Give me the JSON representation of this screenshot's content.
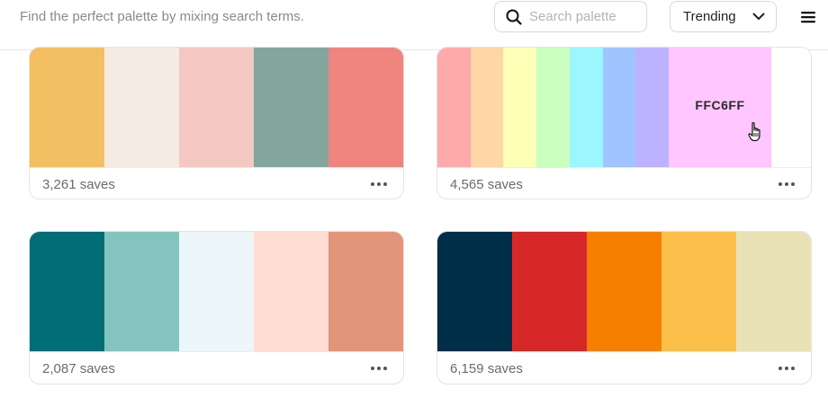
{
  "header": {
    "tagline": "Find the perfect palette by mixing search terms.",
    "search": {
      "placeholder": "Search palette",
      "value": ""
    },
    "sort": {
      "selected": "Trending"
    },
    "icons": {
      "search": "search-icon",
      "sort": "chevron-down-icon",
      "menu": "hamburger-menu-icon"
    }
  },
  "palettes": [
    {
      "colors": [
        "#F4BE62",
        "#F5EBE2",
        "#F5C7C1",
        "#84A59E",
        "#F0847F"
      ],
      "saves": "3,261 saves"
    },
    {
      "colors": [
        "#FFAAAA",
        "#FFD6A5",
        "#FDFFB6",
        "#CAFFBF",
        "#9BF6FF",
        "#A0C4FF",
        "#BDB2FF",
        "#FFC6FF",
        "#FFFFFF"
      ],
      "hovered_label": "FFC6FF",
      "saves": "4,565 saves"
    },
    {
      "colors": [
        "#006D77",
        "#83C5BE",
        "#EDF6F9",
        "#FFDDD2",
        "#E29578"
      ],
      "saves": "2,087 saves"
    },
    {
      "colors": [
        "#003049",
        "#D62828",
        "#F77F00",
        "#FCBF49",
        "#EAE2B7"
      ],
      "saves": "6,159 saves"
    }
  ]
}
